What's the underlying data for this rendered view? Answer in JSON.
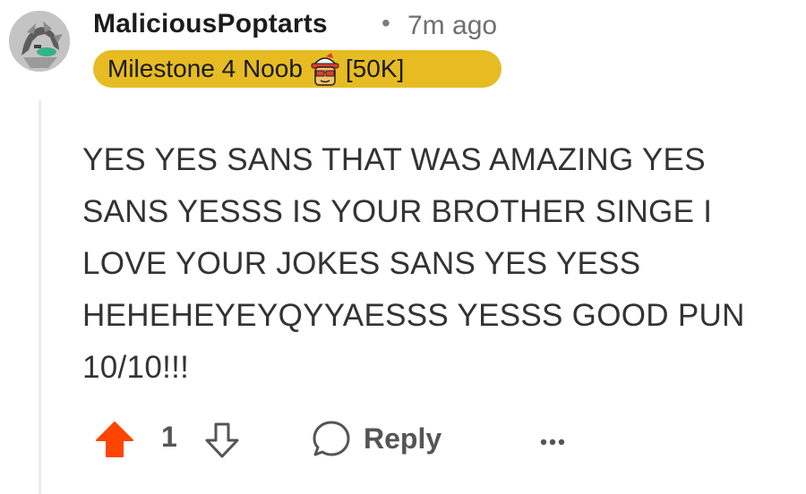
{
  "comment": {
    "author": "MaliciousPoptarts",
    "separator": "•",
    "time": "7m ago",
    "flair": {
      "label": "Milestone 4 Noob",
      "suffix": "[50K]",
      "color": "#e6bc22"
    },
    "body": "YES YES SANS THAT WAS AMAZING YES SANS YESSS IS YOUR BROTHER SINGE I LOVE YOUR JOKES SANS YES YESS HEHEHEYEYQYYAESSS YESSS GOOD PUN 10/10!!!"
  },
  "actions": {
    "upvote_icon": "upvote-arrow-filled-icon",
    "upvote_color": "#ff4500",
    "score": "1",
    "downvote_icon": "downvote-arrow-icon",
    "reply_icon": "speech-bubble-icon",
    "reply_label": "Reply",
    "more_icon": "ellipsis-icon"
  }
}
